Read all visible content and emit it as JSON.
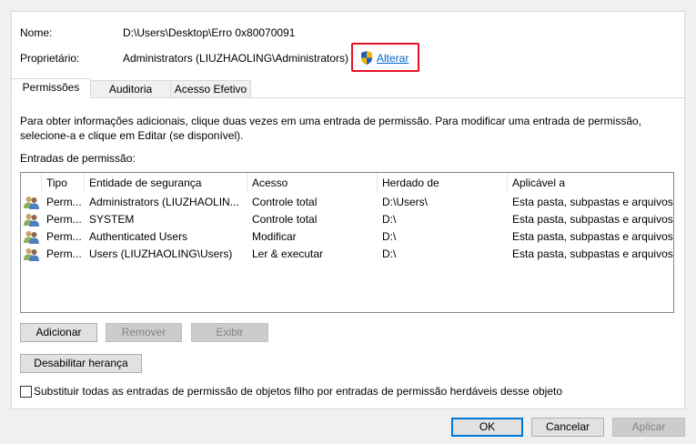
{
  "info": {
    "name_label": "Nome:",
    "name_value": "D:\\Users\\Desktop\\Erro 0x80070091",
    "owner_label": "Proprietário:",
    "owner_value": "Administrators (LIUZHAOLING\\Administrators)",
    "change_link": "Alterar"
  },
  "tabs": [
    {
      "label": "Permissões",
      "active": true
    },
    {
      "label": "Auditoria"
    },
    {
      "label": "Acesso Efetivo"
    }
  ],
  "help_text": "Para obter informações adicionais, clique duas vezes em uma entrada de permissão. Para modificar uma entrada de permissão, selecione-a e clique em Editar (se disponível).",
  "entries_label": "Entradas de permissão:",
  "columns": [
    "Tipo",
    "Entidade de segurança",
    "Acesso",
    "Herdado de",
    "Aplicável a"
  ],
  "rows": [
    [
      "Perm...",
      "Administrators (LIUZHAOLIN...",
      "Controle total",
      "D:\\Users\\",
      "Esta pasta, subpastas e arquivos"
    ],
    [
      "Perm...",
      "SYSTEM",
      "Controle total",
      "D:\\",
      "Esta pasta, subpastas e arquivos"
    ],
    [
      "Perm...",
      "Authenticated Users",
      "Modificar",
      "D:\\",
      "Esta pasta, subpastas e arquivos"
    ],
    [
      "Perm...",
      "Users (LIUZHAOLING\\Users)",
      "Ler & executar",
      "D:\\",
      "Esta pasta, subpastas e arquivos"
    ]
  ],
  "buttons": {
    "add": "Adicionar",
    "remove": "Remover",
    "view": "Exibir",
    "disable_inheritance": "Desabilitar herança",
    "ok": "OK",
    "cancel": "Cancelar",
    "apply": "Aplicar"
  },
  "replace_checkbox": {
    "label": "Substituir todas as entradas de permissão de objetos filho por entradas de permissão herdáveis desse objeto",
    "checked": false
  }
}
